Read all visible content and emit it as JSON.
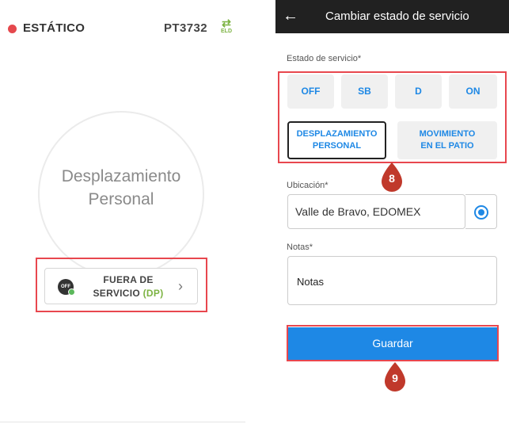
{
  "left": {
    "status": "ESTÁTICO",
    "truck_id": "PT3732",
    "eld_label": "ELD",
    "duty_line1": "Desplazamiento",
    "duty_line2": "Personal",
    "off_icon_text": "OFF",
    "card_line1": "FUERA DE",
    "card_line2_prefix": "SERVICIO ",
    "card_line2_tag": "(DP)"
  },
  "right": {
    "header_title": "Cambiar estado de servicio",
    "status_label": "Estado de servicio*",
    "status_options": [
      "OFF",
      "SB",
      "D",
      "ON"
    ],
    "special_options": [
      {
        "line1": "DESPLAZAMIENTO",
        "line2": "PERSONAL",
        "selected": true
      },
      {
        "line1": "MOVIMIENTO",
        "line2": "EN EL PATIO",
        "selected": false
      }
    ],
    "marker_8": "8",
    "location_label": "Ubicación*",
    "location_value": "Valle de Bravo, EDOMEX",
    "notes_label": "Notas*",
    "notes_value": "Notas",
    "save_label": "Guardar",
    "marker_9": "9"
  },
  "colors": {
    "accent_blue": "#1e88e5",
    "highlight_red": "#e8474e",
    "marker_red": "#c0392b",
    "status_red": "#e5484d",
    "eld_green": "#7cb342",
    "header_dark": "#212121"
  },
  "icons": [
    "back-arrow-icon",
    "eld-sync-icon",
    "off-status-icon",
    "chevron-right-icon",
    "gps-radio-icon",
    "map-marker-icon"
  ]
}
